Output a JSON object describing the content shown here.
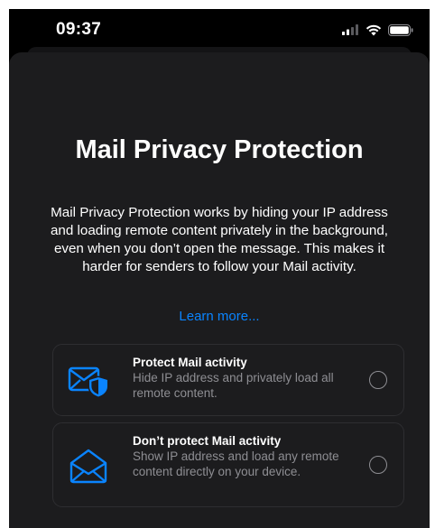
{
  "status_bar": {
    "time": "09:37",
    "icons": [
      "cellular-signal-icon",
      "wifi-icon",
      "battery-icon"
    ]
  },
  "sheet": {
    "title": "Mail Privacy Protection",
    "description": "Mail Privacy Protection works by hiding your IP address and loading remote content privately in the background, even when you don’t open the message. This makes it harder for senders to follow your Mail activity.",
    "learn_more": "Learn more..."
  },
  "options": [
    {
      "title": "Protect Mail activity",
      "description": "Hide IP address and privately load all remote content.",
      "icon": "envelope-shield-icon",
      "selected": false
    },
    {
      "title": "Don’t protect Mail activity",
      "description": "Show IP address and load any remote content directly on your device.",
      "icon": "open-envelope-icon",
      "selected": false
    }
  ],
  "colors": {
    "background": "#000000",
    "sheet": "#1c1c1e",
    "accent": "#0a84ff",
    "secondary_text": "#8e8e93"
  }
}
